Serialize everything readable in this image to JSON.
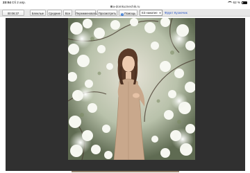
{
  "status_bar": {
    "time": "23:04",
    "date": "Сб 2 апр.",
    "battery_percent": "62 %"
  },
  "url": "a-domkuznechik.ru",
  "toolbar": {
    "timer": "00:06:37",
    "buttons": [
      "Блеклые",
      "Средние",
      "Все"
    ],
    "rename_label": "Переименовать",
    "view_label": "Просмотреть",
    "help_label": "Помощь",
    "select_value": "ЕЗ нажатие",
    "user_name": "Фрукт Кузнечик"
  },
  "colors": {
    "toolbar_background": "#e7e7e7",
    "viewer_background": "#303030",
    "link_blue": "#2a56c6",
    "help_blue": "#3a7bd5"
  },
  "photo": {
    "subject": "young woman in beige dress among white blossoming apple tree",
    "icon_names": [
      "wifi-icon",
      "battery-icon",
      "lock-icon",
      "help-icon",
      "chevron-down-icon"
    ]
  }
}
